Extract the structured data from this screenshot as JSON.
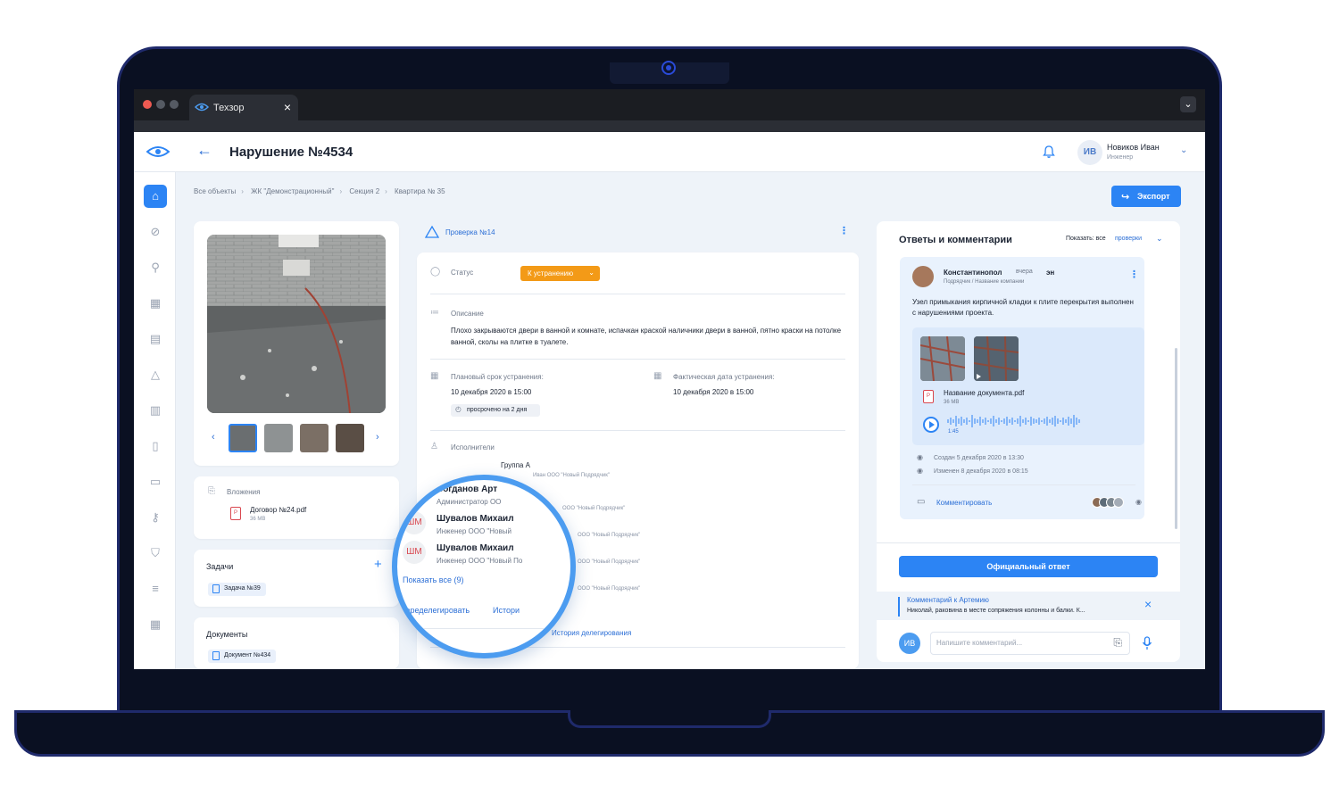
{
  "browser": {
    "tab_title": "Техзор",
    "tab_close": "×",
    "menu_chevron": "⌄"
  },
  "header": {
    "page_title": "Нарушение №4534",
    "back_icon": "arrow-left-icon",
    "user_initials": "ИВ",
    "user_name": "Новиков Иван",
    "user_role": "Инженер",
    "chevron": "⌄"
  },
  "sidebar": {
    "icons": [
      "home-icon",
      "ban-icon",
      "search-icon",
      "calendar-icon",
      "list-icon",
      "warning-icon",
      "doc-check-icon",
      "clipboard-icon",
      "building-icon",
      "key-icon",
      "shield-icon",
      "gantt-icon",
      "calculator-icon"
    ]
  },
  "breadcrumb": [
    "Все объекты",
    "ЖК \"Демонстрационный\"",
    "Секция 2",
    "Квартира № 35"
  ],
  "export_label": "Экспорт",
  "attachments": {
    "title": "Вложения",
    "file_name": "Договор №24.pdf",
    "file_size": "36 MB"
  },
  "tasks": {
    "title": "Задачи",
    "add": "+",
    "chip": "Задача №39"
  },
  "documents": {
    "title": "Документы",
    "chip": "Документ №434"
  },
  "inspection": {
    "title": "Проверка №14",
    "status_label": "Статус",
    "status_value": "К устранению",
    "description_label": "Описание",
    "description": "Плохо закрываются двери в ванной и комнате, испачкан краской наличники двери в ванной, пятно краски на потолке ванной, сколы на плитке в туалете.",
    "planned_label": "Плановый срок устранения:",
    "planned_value": "10 декабря 2020 в 15:00",
    "overdue": "просрочено на 2 дня",
    "actual_label": "Фактическая дата устранения:",
    "actual_value": "10 декабря 2020 в 15:00",
    "executors_label": "Исполнители",
    "bg_rows": [
      "Группа А",
      "Иван   ООО \"Новый Подрядчик\"",
      "ООО \"Новый Подрядчик\"",
      "ООО \"Новый Подрядчик\"",
      "ООО \"Новый Подрядчик\"",
      "ООО \"Новый Подрядчик\"",
      "История делегирования"
    ]
  },
  "magnifier": {
    "people": [
      {
        "initials": "БА",
        "name": "Богданов Арт",
        "role": "Администратор   ОО"
      },
      {
        "initials": "ШМ",
        "name": "Шувалов Михаил",
        "role": "Инженер   ООО \"Новый"
      },
      {
        "initials": "ШМ",
        "name": "Шувалов Михаил",
        "role": "Инженер   ООО \"Новый По"
      }
    ],
    "show_all": "Показать все (9)",
    "redelegate": "Переделегировать",
    "history": "Истори"
  },
  "comments": {
    "title": "Ответы и комментарии",
    "filter_prefix": "Показать: все",
    "filter_link": "проверки",
    "author": "Константинопол",
    "time": "вчера",
    "author_suffix": "эн",
    "author_role": "Подрядчик / Название компании",
    "text": "Узел примыкания кирпичной кладки к плите перекрытия выполнен с нарушениями проекта.",
    "doc_name": "Название документа.pdf",
    "doc_size": "36 MB",
    "audio_time": "1:45",
    "created": "Создан 5 декабря 2020 в 13:30",
    "edited": "Изменен 8 декабря 2020 в 08:15",
    "comment_action": "Комментировать",
    "official_reply": "Официальный ответ",
    "reply_title": "Комментарий к Артемию",
    "reply_text": "Николай, раковина в месте сопряжения колонны и балки. К...",
    "input_placeholder": "Напишите комментарий...",
    "input_initials": "ИВ"
  },
  "colors": {
    "accent": "#2c84f4",
    "status": "#f39a17",
    "laptop_frame": "#0a1022",
    "laptop_border": "#1f2a6b"
  }
}
